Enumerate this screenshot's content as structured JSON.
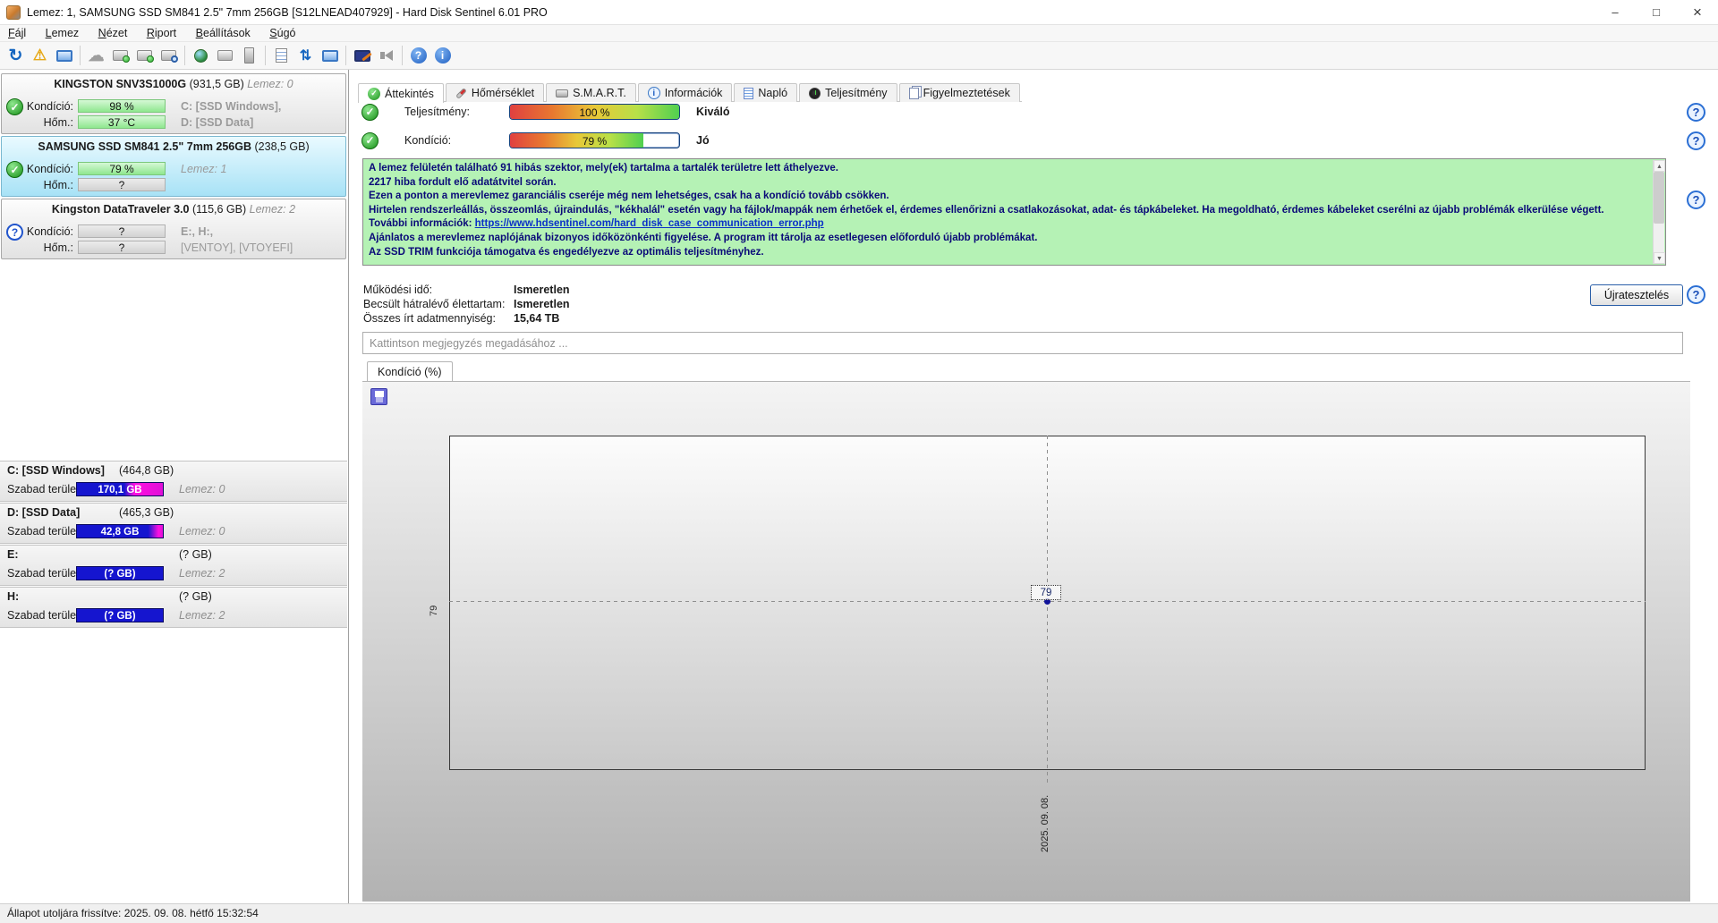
{
  "window": {
    "title": "Lemez: 1, SAMSUNG SSD SM841 2.5\" 7mm 256GB [S12LNEAD407929]  -  Hard Disk Sentinel 6.01 PRO"
  },
  "menu": {
    "items": [
      "Fájl",
      "Lemez",
      "Nézet",
      "Riport",
      "Beállítások",
      "Súgó"
    ]
  },
  "toolbar": {
    "icons": [
      "refresh",
      "disk-warning",
      "disk-monitor",
      "disk-offline",
      "disk-accept",
      "disk-test",
      "disk-search",
      "network-disk",
      "removable-disk",
      "server",
      "report",
      "sync",
      "web-status",
      "desktop-edit",
      "sound",
      "help",
      "info"
    ]
  },
  "sidebar": {
    "disks": [
      {
        "name": "KINGSTON SNV3S1000G",
        "size": "(931,5 GB)",
        "lemez": "Lemez: 0",
        "status": "ok",
        "rows": [
          {
            "label": "Kondíció:",
            "value": "98 %",
            "bar": "green",
            "extra": "C: [SSD Windows],"
          },
          {
            "label": "Hőm.:",
            "value": "37 °C",
            "bar": "green",
            "extra": "D: [SSD Data]"
          }
        ]
      },
      {
        "name": "SAMSUNG SSD SM841 2.5\" 7mm 256GB",
        "size": "(238,5 GB)",
        "lemez": "",
        "status": "ok",
        "rows": [
          {
            "label": "Kondíció:",
            "value": "79 %",
            "bar": "green",
            "extra": "Lemez: 1"
          },
          {
            "label": "Hőm.:",
            "value": "?",
            "bar": "gray",
            "extra": ""
          }
        ]
      },
      {
        "name": "Kingston DataTraveler 3.0",
        "size": "(115,6 GB)",
        "lemez": "Lemez: 2",
        "status": "unknown",
        "rows": [
          {
            "label": "Kondíció:",
            "value": "?",
            "bar": "gray",
            "extra": "E:, H:,"
          },
          {
            "label": "Hőm.:",
            "value": "?",
            "bar": "gray",
            "extra": "[VENTOY],  [VTOYEFI]"
          }
        ]
      }
    ],
    "free_space_label": "Szabad terület",
    "partitions": [
      {
        "name": "C: [SSD Windows]",
        "size": "(464,8 GB)",
        "free": "170,1 GB",
        "lemez": "Lemez: 0",
        "free_pct": 37
      },
      {
        "name": "D: [SSD Data]",
        "size": "(465,3 GB)",
        "free": "42,8 GB",
        "lemez": "Lemez: 0",
        "free_pct": 9
      },
      {
        "name": "E:",
        "size": "(? GB)",
        "free": "(? GB)",
        "lemez": "Lemez: 2",
        "free_pct": 0
      },
      {
        "name": "H:",
        "size": "(? GB)",
        "free": "(? GB)",
        "lemez": "Lemez: 2",
        "free_pct": 0
      }
    ]
  },
  "tabs": [
    {
      "label": "Áttekintés",
      "selected": true
    },
    {
      "label": "Hőmérséklet",
      "selected": false
    },
    {
      "label": "S.M.A.R.T.",
      "selected": false
    },
    {
      "label": "Információk",
      "selected": false
    },
    {
      "label": "Napló",
      "selected": false
    },
    {
      "label": "Teljesítmény",
      "selected": false
    },
    {
      "label": "Figyelmeztetések",
      "selected": false
    }
  ],
  "overview": {
    "performance": {
      "label": "Teljesítmény:",
      "value": "100 %",
      "pct": 100,
      "rating": "Kiváló"
    },
    "condition": {
      "label": "Kondíció:",
      "value": "79 %",
      "pct": 79,
      "rating": "Jó"
    },
    "notes": {
      "lines_before": [
        "A lemez felületén található 91 hibás szektor, mely(ek) tartalma a tartalék területre lett áthelyezve.",
        "2217 hiba fordult elő adatátvitel során.",
        "Ezen a ponton a merevlemez garanciális cseréje még nem lehetséges, csak ha a kondíció tovább csökken.",
        "Hirtelen rendszerleállás, összeomlás, újraindulás, \"kékhalál\" esetén vagy ha fájlok/mappák nem érhetőek el, érdemes ellenőrizni a csatlakozásokat, adat- és tápkábeleket. Ha megoldható, érdemes kábeleket cserélni az újabb problémák elkerülése végett."
      ],
      "link_prefix": "További információk: ",
      "link_url": "https://www.hdsentinel.com/hard_disk_case_communication_error.php",
      "lines_after": [
        "Ajánlatos a merevlemez naplójának bizonyos időközönkénti figyelése. A program itt tárolja az esetlegesen előforduló újabb problémákat.",
        "Az SSD TRIM funkciója támogatva és engedélyezve az optimális teljesítményhez."
      ]
    },
    "stats": [
      {
        "label": "Működési idő:",
        "value": "Ismeretlen"
      },
      {
        "label": "Becsült hátralévő élettartam:",
        "value": "Ismeretlen"
      },
      {
        "label": "Összes írt adatmennyiség:",
        "value": "15,64 TB"
      }
    ],
    "retest_label": "Újratesztelés",
    "comment_placeholder": "Kattintson megjegyzés megadásához ...",
    "chart_tab_label": "Kondíció  (%)"
  },
  "chart_data": {
    "type": "line",
    "title": "Kondíció (%)",
    "x": [
      "2025. 09. 08."
    ],
    "values": [
      79
    ],
    "point_label": "79",
    "y_tick_labels": [
      "79"
    ],
    "grid": "dashed-crosshair",
    "legend": false
  },
  "statusbar": {
    "text": "Állapot utoljára frissítve: 2025. 09. 08. hétfő 15:32:54"
  },
  "colors": {
    "green_bar": "#8fe78f",
    "selected_disk_bg": "#a8e2f6",
    "free_bar_blue": "#1515cf",
    "free_bar_magenta": "#ff10e0",
    "notes_bg": "#b5f2b5",
    "notes_text": "#0a0a78",
    "link_blue": "#0a30c8",
    "metric_border": "#16417c",
    "point_navy": "#10129a"
  }
}
